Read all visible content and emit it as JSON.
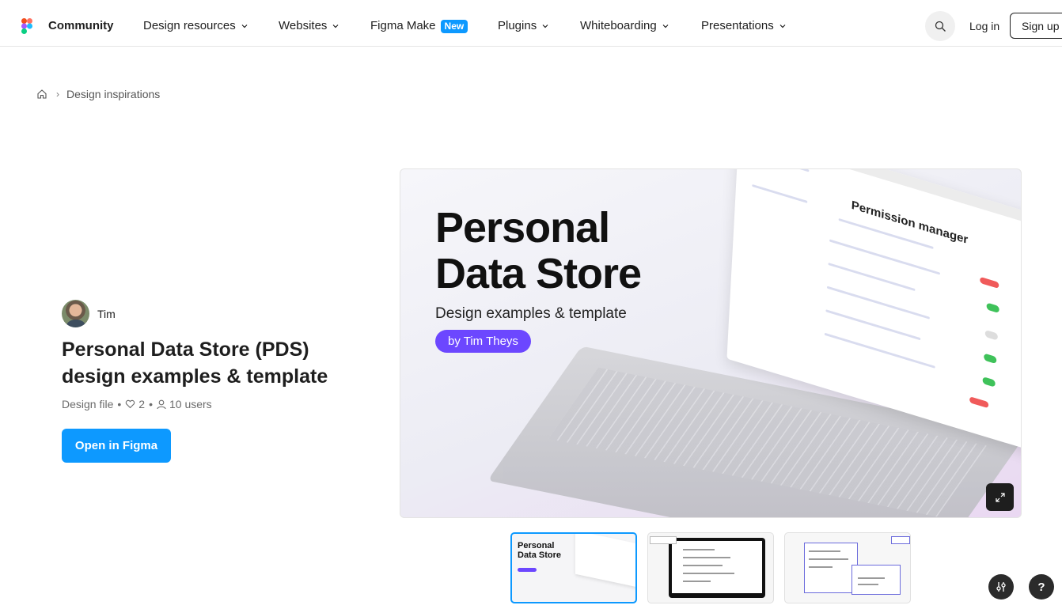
{
  "nav": {
    "brand": "Community",
    "items": [
      {
        "label": "Design resources",
        "has_dropdown": true
      },
      {
        "label": "Websites",
        "has_dropdown": true
      },
      {
        "label": "Figma Make",
        "badge": "New",
        "has_dropdown": false
      },
      {
        "label": "Plugins",
        "has_dropdown": true
      },
      {
        "label": "Whiteboarding",
        "has_dropdown": true
      },
      {
        "label": "Presentations",
        "has_dropdown": true
      }
    ],
    "search_icon": "search-icon",
    "login": "Log in",
    "signup": "Sign up"
  },
  "breadcrumb": {
    "home_icon": "home-icon",
    "current": "Design inspirations"
  },
  "file": {
    "author": "Tim",
    "title": "Personal Data Store (PDS) design examples & template",
    "type": "Design file",
    "likes": "2",
    "users": "10 users",
    "open_button": "Open in Figma"
  },
  "hero": {
    "title_line1": "Personal",
    "title_line2": "Data Store",
    "subtitle": "Design examples & template",
    "pill": "by Tim Theys",
    "screen_heading": "Permission manager"
  },
  "thumbnails": [
    {
      "title_line1": "Personal",
      "title_line2": "Data Store",
      "active": true
    },
    {
      "active": false
    },
    {
      "active": false
    }
  ],
  "colors": {
    "accent": "#0d99ff",
    "pill": "#6c47ff",
    "text": "#1e1e1e"
  },
  "help_label": "?"
}
